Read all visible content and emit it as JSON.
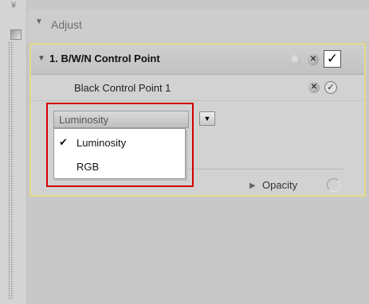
{
  "sidebar": {
    "top_glyph": "¥"
  },
  "adjust": {
    "toggle_icon": "▼",
    "title": "Adjust"
  },
  "control_point": {
    "toggle_icon": "▼",
    "title": "1. B/W/N Control Point",
    "close_icon": "✕",
    "check": "✓"
  },
  "black_control_point": {
    "label": "Black Control Point 1",
    "close_icon": "✕",
    "check": "✓"
  },
  "select": {
    "value": "Luminosity",
    "arrow": "▼",
    "options": [
      {
        "label": "Luminosity",
        "checked": true,
        "check": "✔"
      },
      {
        "label": "RGB",
        "checked": false,
        "check": ""
      }
    ]
  },
  "opacity": {
    "arrow": "▶",
    "label": "Opacity"
  },
  "colors": {
    "highlight": "#d20000",
    "panel_border": "#e4d98a"
  }
}
